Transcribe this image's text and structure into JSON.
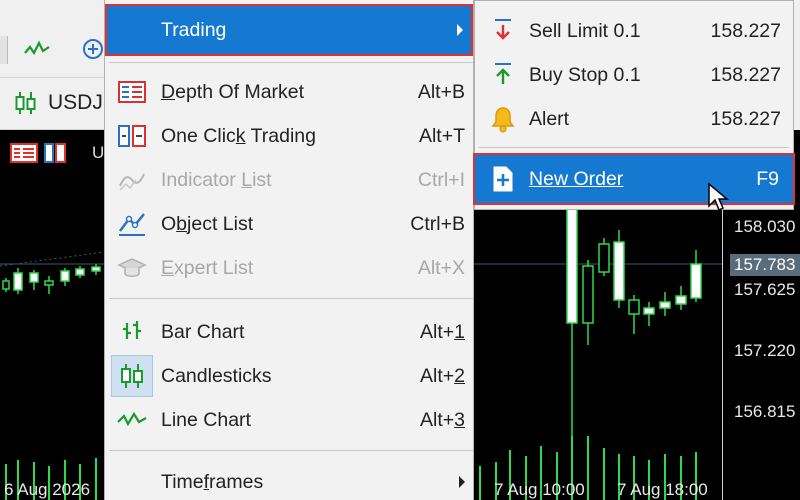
{
  "background": {
    "symbol": "USDJ",
    "chart_label": "U",
    "left_date": "6 Aug 2026",
    "prices": [
      "158.030",
      "157.783",
      "157.625",
      "157.220",
      "156.815"
    ],
    "time_labels": [
      "7 Aug 10:00",
      "7 Aug 18:00"
    ]
  },
  "menu": {
    "trading_label": "Trading",
    "items": [
      {
        "label_pre": "",
        "mnemonic": "D",
        "label_post": "epth Of Market",
        "shortcut": "Alt+B",
        "icon": "depth-of-market-icon",
        "disabled": false
      },
      {
        "label_pre": "One Clic",
        "mnemonic": "k",
        "label_post": " Trading",
        "shortcut": "Alt+T",
        "icon": "one-click-trading-icon",
        "disabled": false
      },
      {
        "label_pre": "Indicator ",
        "mnemonic": "L",
        "label_post": "ist",
        "shortcut": "Ctrl+I",
        "icon": "indicator-list-icon",
        "disabled": true
      },
      {
        "label_pre": "O",
        "mnemonic": "b",
        "label_post": "ject List",
        "shortcut": "Ctrl+B",
        "icon": "object-list-icon",
        "disabled": false
      },
      {
        "label_pre": "",
        "mnemonic": "E",
        "label_post": "xpert List",
        "shortcut": "Alt+X",
        "icon": "expert-list-icon",
        "disabled": true
      },
      {
        "label_pre": "Bar Chart",
        "mnemonic": "",
        "label_post": "",
        "shortcut_pre": "Alt+",
        "shortcut_mn": "1",
        "icon": "bar-chart-icon",
        "disabled": false
      },
      {
        "label_pre": "Candlesticks",
        "mnemonic": "",
        "label_post": "",
        "shortcut_pre": "Alt+",
        "shortcut_mn": "2",
        "icon": "candlesticks-icon",
        "disabled": false
      },
      {
        "label_pre": "Line Chart",
        "mnemonic": "",
        "label_post": "",
        "shortcut_pre": "Alt+",
        "shortcut_mn": "3",
        "icon": "line-chart-icon",
        "disabled": false
      }
    ],
    "timeframes_pre": "Time",
    "timeframes_mn": "f",
    "timeframes_post": "rames"
  },
  "submenu": {
    "items": [
      {
        "label": "Sell Limit 0.1",
        "value": "158.227",
        "icon": "sell-limit-icon"
      },
      {
        "label": "Buy Stop 0.1",
        "value": "158.227",
        "icon": "buy-stop-icon"
      },
      {
        "label": "Alert",
        "value": "158.227",
        "icon": "alert-bell-icon"
      }
    ],
    "new_order_mn": "N",
    "new_order_rest": "ew Order",
    "new_order_shortcut": "F9"
  },
  "colors": {
    "highlight": "#1679d1",
    "outline": "#e03030"
  }
}
